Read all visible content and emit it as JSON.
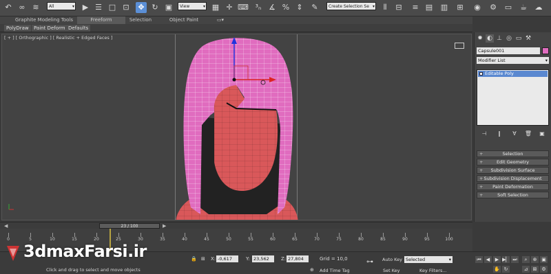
{
  "toolbar": {
    "filter_value": "All",
    "refcoord_value": "View",
    "selection_set_placeholder": "Create Selection Se"
  },
  "ribbon": {
    "tabs": [
      "Graphite Modeling Tools",
      "Freeform",
      "Selection",
      "Object Paint"
    ],
    "subtabs": [
      "PolyDraw",
      "Paint Deform",
      "Defaults"
    ]
  },
  "viewport": {
    "label": "[ + ] [ Orthographic ] [ Realistic + Edged Faces ]"
  },
  "command_panel": {
    "object_name": "Capsule001",
    "object_color": "#e06cbf",
    "modifier_list_label": "Modifier List",
    "stack_item": "Editable Poly",
    "rollouts": [
      "Selection",
      "Edit Geometry",
      "Subdivision Surface",
      "Subdivision Displacement",
      "Paint Deformation",
      "Soft Selection"
    ]
  },
  "time": {
    "slider_label": "23 / 100",
    "current_frame": 23,
    "ticks": [
      0,
      5,
      10,
      15,
      20,
      25,
      30,
      35,
      40,
      45,
      50,
      55,
      60,
      65,
      70,
      75,
      80,
      85,
      90,
      95,
      100
    ]
  },
  "status": {
    "x_value": "-0,617",
    "y_value": "23,562",
    "z_value": "27,804",
    "grid_text": "Grid = 10,0",
    "prompt_text": "Click and drag to select and move objects",
    "add_time_tag": "Add Time Tag",
    "auto_key_label": "Auto Key",
    "set_key_label": "Set Key",
    "key_mode_value": "Selected",
    "key_filters_label": "Key Filters...",
    "x_label": "X:",
    "y_label": "Y:",
    "z_label": "Z:"
  },
  "watermark": {
    "text": "3dmaxFarsi.ir"
  },
  "colors": {
    "selection_accent": "#5a88d0",
    "hair_pink": "#e06cbf",
    "body_red": "#d9585a",
    "wire": "#ffffff"
  }
}
